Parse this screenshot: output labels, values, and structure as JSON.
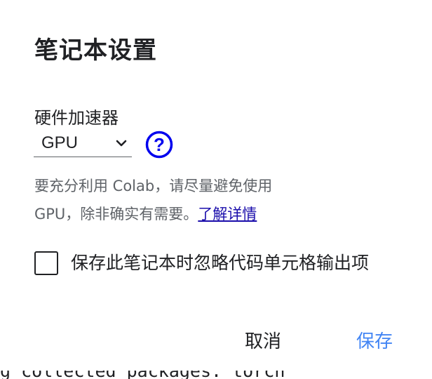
{
  "dialog": {
    "title": "笔记本设置",
    "accelerator_label": "硬件加速器",
    "accelerator_value": "GPU",
    "description_line1": "要充分利用 Colab，请尽量避免使用",
    "description_line2": "GPU，除非确实有需要。",
    "learn_more": "了解详情",
    "omit_output_label": "保存此笔记本时忽略代码单元格输出项",
    "omit_output_checked": false,
    "cancel_label": "取消",
    "save_label": "保存"
  },
  "background": {
    "partial_text": "g collected packages: torch"
  },
  "colors": {
    "save_button": "#4285f4",
    "help_icon": "#0000ee",
    "link": "#1a0dab",
    "description": "#5f6368"
  },
  "icons": {
    "select_chevron": "chevron-down-icon",
    "help": "help-circle-icon"
  }
}
